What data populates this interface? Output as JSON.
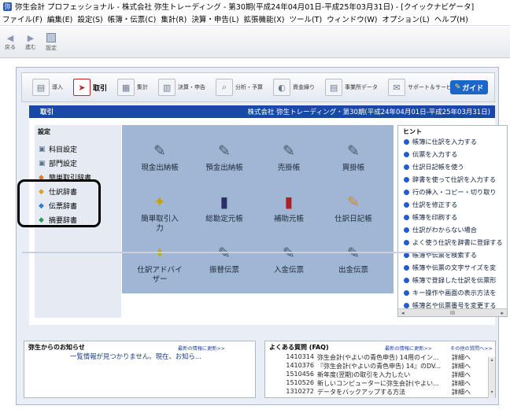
{
  "window": {
    "title": "弥生会計 プロフェッショナル - 株式会社 弥生トレーディング - 第30期(平成24年04月01日-平成25年03月31日) - [クイックナビゲータ]"
  },
  "menu": [
    "ファイル(F)",
    "編集(E)",
    "設定(S)",
    "帳簿・伝票(C)",
    "集計(R)",
    "決算・申告(L)",
    "拡張機能(X)",
    "ツール(T)",
    "ウィンドウ(W)",
    "オプション(L)",
    "ヘルプ(H)"
  ],
  "toolbar": {
    "back": "戻る",
    "forward": "進む",
    "settings": "設定"
  },
  "nav": {
    "items": [
      "導入",
      "取引",
      "集計",
      "決算・申告",
      "分析・予算",
      "資金繰り",
      "事業所データ",
      "サポート＆サービス"
    ],
    "guide": "ガイド"
  },
  "section": {
    "title": "取引",
    "company": "株式会社 弥生トレーディング・第30期(平成24年04月01日-平成25年03月31日)"
  },
  "settings": {
    "title": "設定",
    "items": [
      "科目設定",
      "部門設定",
      "簡単取引辞書",
      "仕訳辞書",
      "伝票辞書",
      "摘要辞書"
    ]
  },
  "tiles": [
    "現金出納帳",
    "預金出納帳",
    "売掛帳",
    "買掛帳",
    "簡単取引入力",
    "総勘定元帳",
    "補助元帳",
    "仕訳日記帳",
    "仕訳アドバイザー",
    "振替伝票",
    "入金伝票",
    "出金伝票"
  ],
  "hints": {
    "title": "ヒント",
    "items": [
      "帳簿に仕訳を入力する",
      "伝票を入力する",
      "仕訳日記帳を使う",
      "辞書を使って仕訳を入力する",
      "行の挿入・コピー・切り取り",
      "仕訳を修正する",
      "帳簿を印刷する",
      "仕訳がわからない場合",
      "よく使う仕訳を辞書に登録する",
      "帳簿や伝票を検索する",
      "帳簿や伝票の文字サイズを変",
      "帳簿で登録した仕訳を伝票形",
      "キー操作や画面の表示方法を",
      "帳簿名や伝票番号を変更する"
    ],
    "scroll_mark": "III"
  },
  "news": {
    "title": "弥生からのお知らせ",
    "link": "最新の情報に更新>>",
    "message": "一覧情報が見つかりません。現在、お知ら..."
  },
  "faq": {
    "title": "よくある質問 (FAQ)",
    "refresh": "最新の情報に更新>>",
    "more": "その他の質問へ>>",
    "rows": [
      {
        "id": "1410314",
        "title": "弥生会計(やよいの青色申告) 14用のイン...",
        "detail": "詳細へ"
      },
      {
        "id": "1410376",
        "title": "『弥生会計(やよいの青色申告) 14』のDV...",
        "detail": "詳細へ"
      },
      {
        "id": "1510456",
        "title": "新年度(翌期)の取引を入力したい",
        "detail": "詳細へ"
      },
      {
        "id": "1510526",
        "title": "新しいコンピューターに弥生会計(やよい...",
        "detail": "詳細へ"
      },
      {
        "id": "1310272",
        "title": "データをバックアップする方法",
        "detail": "詳細へ"
      }
    ]
  }
}
